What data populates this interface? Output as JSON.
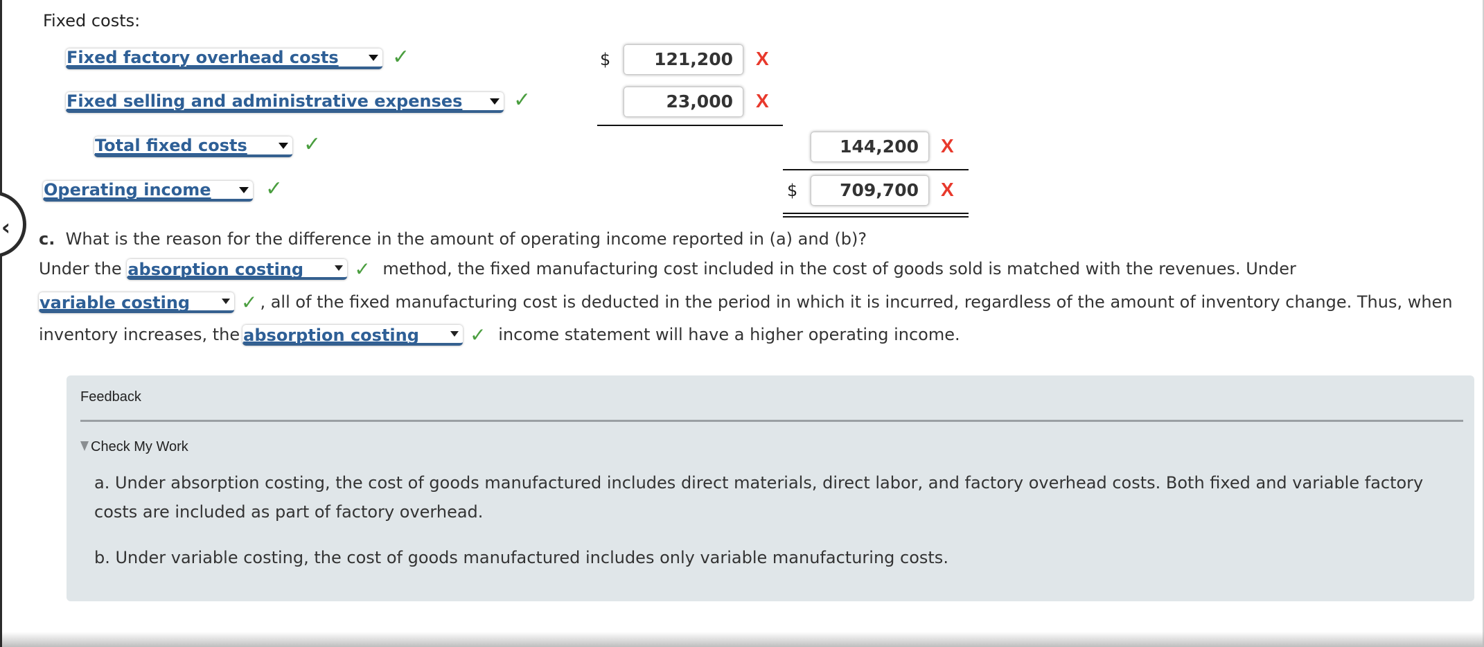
{
  "section_label": "Fixed costs:",
  "currency_symbol": "$",
  "rows": [
    {
      "label": "Fixed factory overhead costs",
      "status": "correct",
      "amount": "121,200",
      "amount_status": "incorrect"
    },
    {
      "label": "Fixed selling and administrative expenses",
      "status": "correct",
      "amount": "23,000",
      "amount_status": "incorrect"
    },
    {
      "label": "Total fixed costs",
      "status": "correct",
      "amount": "144,200",
      "amount_status": "incorrect"
    },
    {
      "label": "Operating income",
      "status": "correct",
      "amount": "709,700",
      "amount_status": "incorrect"
    }
  ],
  "icons": {
    "correct": "✓",
    "incorrect": "X",
    "nav_prev": "‹"
  },
  "colors": {
    "correct": "#4a9e3f",
    "incorrect": "#e8392c",
    "dropdown_text": "#2e5f96",
    "feedback_bg": "#e0e6e9"
  },
  "question_c": {
    "prefix": "c.",
    "question": "What is the reason for the difference in the amount of operating income reported in (a) and (b)?",
    "line1_before": "Under the",
    "dropdown1": "absorption costing",
    "line1_after": "method, the fixed manufacturing cost included in the cost of goods sold is matched with the revenues. Under",
    "dropdown2": "variable costing",
    "line2_after": ", all of the fixed manufacturing cost is deducted in the period in which it is incurred, regardless of the amount of inventory change. Thus, when",
    "line3_before": "inventory increases, the",
    "dropdown3": "absorption costing",
    "line3_after": "income statement will have a higher operating income."
  },
  "feedback": {
    "title": "Feedback",
    "toggle_label": "Check My Work",
    "item_a": "a. Under absorption costing, the cost of goods manufactured includes direct materials, direct labor, and factory overhead costs. Both fixed and variable factory costs are included as part of factory overhead.",
    "item_b": "b. Under variable costing, the cost of goods manufactured includes only variable manufacturing costs."
  }
}
